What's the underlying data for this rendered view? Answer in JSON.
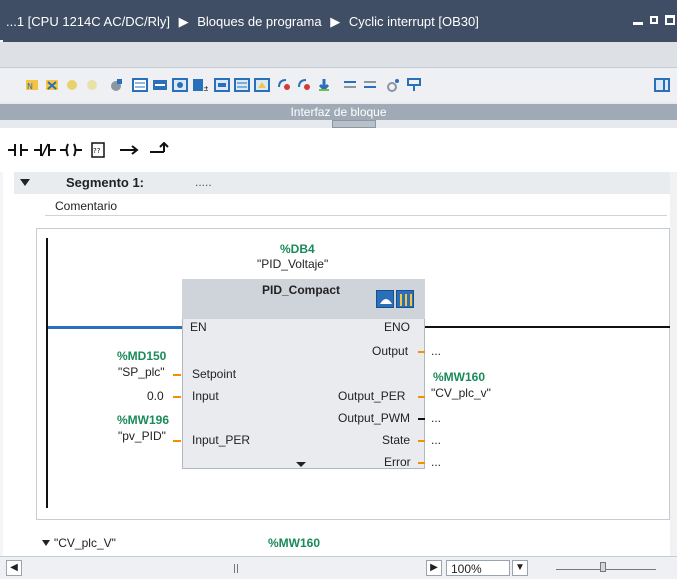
{
  "titlebar": {
    "crumb1": "...1 [CPU 1214C AC/DC/Rly]",
    "sep1": "▶",
    "crumb2": "Bloques de programa",
    "sep2": "▶",
    "crumb3": "Cyclic interrupt [OB30]"
  },
  "interface_bar": {
    "label": "Interfaz de bloque"
  },
  "segment": {
    "title": "Segmento 1:",
    "dots": ".....",
    "comment": "Comentario"
  },
  "pid_block": {
    "db_address": "%DB4",
    "db_name": "\"PID_Voltaje\"",
    "type": "PID_Compact",
    "pin_en": "EN",
    "pin_eno": "ENO",
    "pin_output": "Output",
    "pin_setpoint": "Setpoint",
    "pin_input": "Input",
    "pin_output_per": "Output_PER",
    "pin_output_pwm": "Output_PWM",
    "pin_input_per": "Input_PER",
    "pin_state": "State",
    "pin_error": "Error"
  },
  "operands": {
    "setpoint_addr": "%MD150",
    "setpoint_tag": "\"SP_plc\"",
    "input_value": "0.0",
    "output_placeholder": "...",
    "output_per_addr": "%MW160",
    "output_per_tag": "\"CV_plc_v\"",
    "input_per_addr": "%MW196",
    "input_per_tag": "\"pv_PID\"",
    "pwm_placeholder": "...",
    "state_placeholder": "...",
    "error_placeholder": "..."
  },
  "variable_info": {
    "tag": "\"CV_plc_V\"",
    "address": "%MW160"
  },
  "status_bar": {
    "zoom": "100%"
  },
  "colors": {
    "titlebar": "#3f4e64",
    "address_green": "#1a8a5a",
    "wire_orange": "#f29100",
    "toolbar_blue": "#2a6fba"
  }
}
